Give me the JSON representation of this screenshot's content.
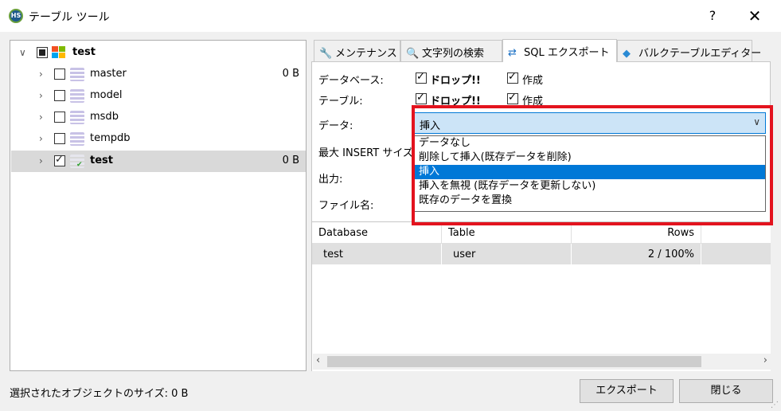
{
  "window": {
    "title": "テーブル ツール",
    "help": "?",
    "close": "✕",
    "app_icon_text": "HS"
  },
  "tree": {
    "root": {
      "label": "test"
    },
    "items": [
      {
        "label": "master",
        "size": "0 B"
      },
      {
        "label": "model",
        "size": ""
      },
      {
        "label": "msdb",
        "size": ""
      },
      {
        "label": "tempdb",
        "size": ""
      },
      {
        "label": "test",
        "size": "0 B"
      }
    ]
  },
  "tabs": [
    {
      "label": "メンテナンス",
      "icon": "wrench-icon"
    },
    {
      "label": "文字列の検索",
      "icon": "search-icon"
    },
    {
      "label": "SQL エクスポート",
      "icon": "export-icon"
    },
    {
      "label": "バルクテーブルエディター",
      "icon": "bulk-icon"
    }
  ],
  "export": {
    "database_label": "データベース:",
    "table_label": "テーブル:",
    "drop_label": "ドロップ!!",
    "create_label": "作成",
    "data_label": "データ:",
    "max_insert_label": "最大 INSERT サイズ",
    "output_label": "出力:",
    "filename_label": "ファイル名:",
    "data_selected": "挿入",
    "data_options": [
      "データなし",
      "削除して挿入(既存データを削除)",
      "挿入",
      "挿入を無視 (既存データを更新しない)",
      "既存のデータを置換"
    ]
  },
  "grid": {
    "columns": [
      "Database",
      "Table",
      "Rows"
    ],
    "rows": [
      [
        "test",
        "user",
        "2 / 100%"
      ]
    ]
  },
  "status_text": "選択されたオブジェクトのサイズ: 0 B",
  "buttons": {
    "export": "エクスポート",
    "close": "閉じる"
  },
  "colors": {
    "highlight": "#0078d7",
    "annotation_box": "#e3131e",
    "selected_row": "#d9d9d9"
  }
}
